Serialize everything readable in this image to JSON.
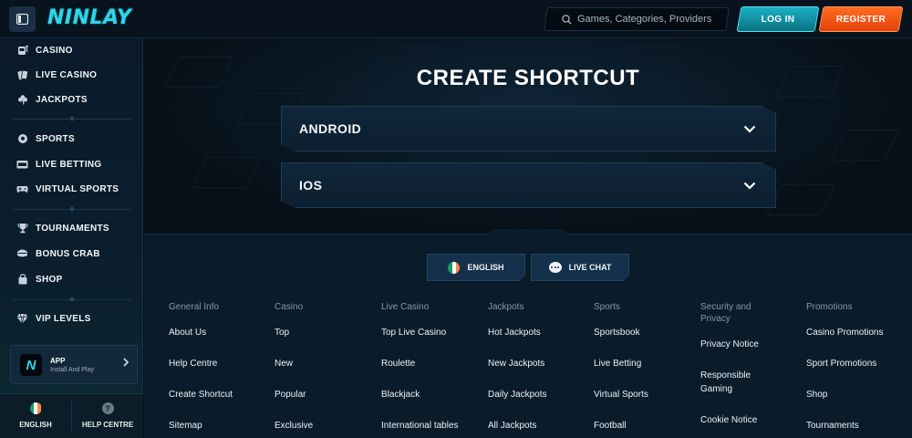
{
  "header": {
    "logo": "NINLAY",
    "search_placeholder": "Games, Categories, Providers",
    "login": "LOG IN",
    "register": "REGISTER"
  },
  "sidebar": {
    "items": [
      {
        "label": "CASINO",
        "icon": "slot-machine-icon"
      },
      {
        "label": "LIVE CASINO",
        "icon": "cards-icon"
      },
      {
        "label": "JACKPOTS",
        "icon": "clover-icon"
      },
      {
        "label": "SPORTS",
        "icon": "ball-icon"
      },
      {
        "label": "LIVE BETTING",
        "icon": "live-tv-icon"
      },
      {
        "label": "VIRTUAL SPORTS",
        "icon": "gamepad-icon"
      },
      {
        "label": "TOURNAMENTS",
        "icon": "trophy-icon"
      },
      {
        "label": "BONUS CRAB",
        "icon": "crab-icon"
      },
      {
        "label": "SHOP",
        "icon": "shop-icon"
      },
      {
        "label": "VIP LEVELS",
        "icon": "diamond-icon"
      }
    ],
    "app": {
      "title": "APP",
      "subtitle": "Install And Play"
    },
    "language": "ENGLISH",
    "help": "HELP CENTRE"
  },
  "main": {
    "title": "CREATE SHORTCUT",
    "accordions": [
      "ANDROID",
      "IOS"
    ]
  },
  "footer": {
    "language_button": "ENGLISH",
    "live_chat_button": "LIVE CHAT",
    "columns": [
      {
        "heading": "General Info",
        "links": [
          "About Us",
          "Help Centre",
          "Create Shortcut",
          "Sitemap"
        ]
      },
      {
        "heading": "Casino",
        "links": [
          "Top",
          "New",
          "Popular",
          "Exclusive"
        ]
      },
      {
        "heading": "Live Casino",
        "links": [
          "Top Live Casino",
          "Roulette",
          "Blackjack",
          "International tables"
        ]
      },
      {
        "heading": "Jackpots",
        "links": [
          "Hot Jackpots",
          "New Jackpots",
          "Daily Jackpots",
          "All Jackpots"
        ]
      },
      {
        "heading": "Sports",
        "links": [
          "Sportsbook",
          "Live Betting",
          "Virtual Sports",
          "Football"
        ]
      },
      {
        "heading": "Security and Privacy",
        "links": [
          "Privacy Notice",
          "Responsible Gaming",
          "Cookie Notice"
        ]
      },
      {
        "heading": "Promotions",
        "links": [
          "Casino Promotions",
          "Sport Promotions",
          "Shop",
          "Tournaments"
        ]
      }
    ]
  },
  "colors": {
    "accent": "#2fd5e8",
    "login": "#1bb0c6",
    "register": "#ff6b24",
    "background": "#081521"
  }
}
